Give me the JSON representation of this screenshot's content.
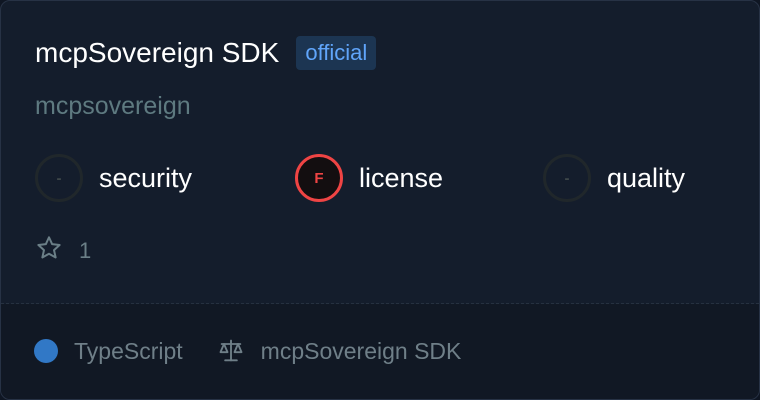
{
  "title": "mcpSovereign SDK",
  "badge": "official",
  "owner": "mcpsovereign",
  "scores": [
    {
      "label": "security",
      "grade": "-",
      "status": "none"
    },
    {
      "label": "license",
      "grade": "F",
      "status": "fail"
    },
    {
      "label": "quality",
      "grade": "-",
      "status": "none"
    }
  ],
  "stars": "1",
  "footer": {
    "language": "TypeScript",
    "language_color": "#3178c6",
    "license": "mcpSovereign SDK"
  },
  "icons": {
    "stars": "star-icon",
    "license": "scale-icon"
  },
  "colors": {
    "badge": "#60a5fa",
    "fail": "#ef4444"
  }
}
